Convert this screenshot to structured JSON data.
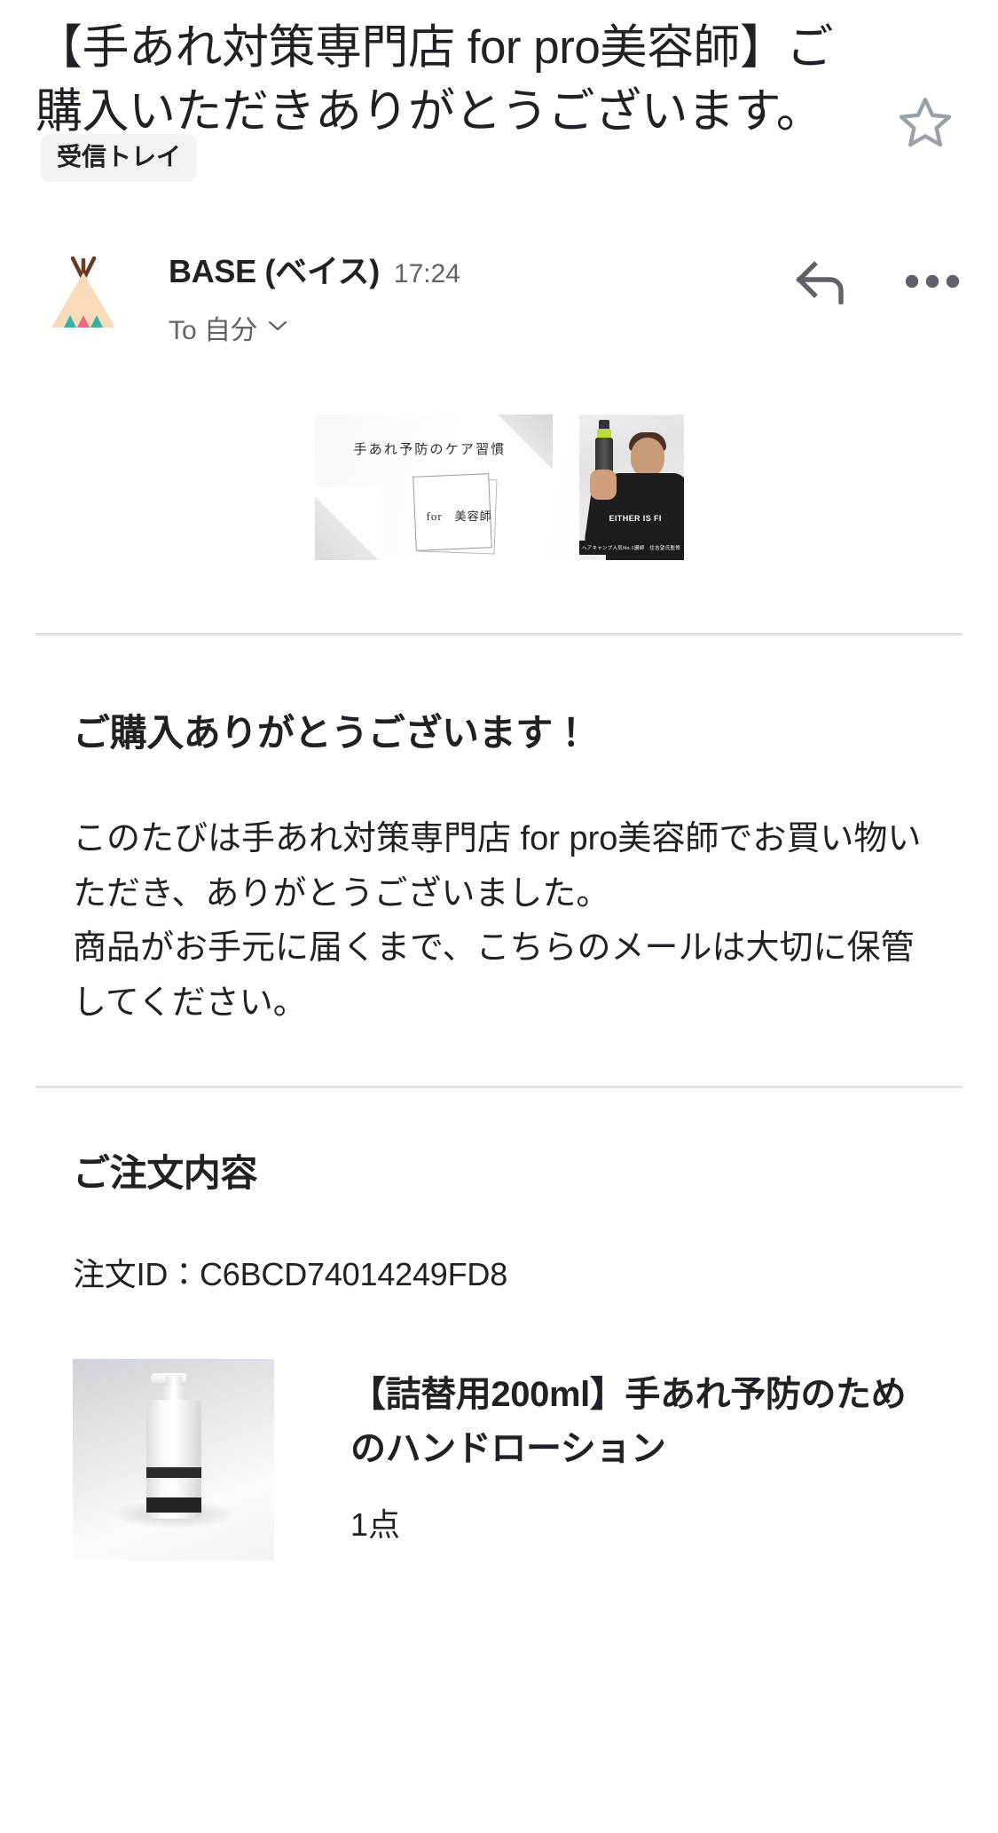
{
  "header": {
    "subject": "【手あれ対策専門店 for pro美容師】ご購入いただきありがとうございます。",
    "label_chip": "受信トレイ",
    "star_icon": "star-outline-icon"
  },
  "sender": {
    "avatar_icon": "teepee-avatar-icon",
    "name": "BASE (ベイス)",
    "time": "17:24",
    "recipient": "To 自分",
    "expand_icon": "chevron-down-icon",
    "reply_icon": "reply-arrow-icon",
    "more_icon": "more-options-icon"
  },
  "banner": {
    "headline": "手あれ予防のケア習慣",
    "card_text": "for　美容師",
    "shirt_text": "EITHER IS FI",
    "caption": "ヘアキャンプ人気No.1講師　住吉望氏監修"
  },
  "body": {
    "greeting": "ご購入ありがとうございます！",
    "paragraph": "このたびは手あれ対策専門店 for pro美容師でお買い物いただき、ありがとうございました。\n商品がお手元に届くまで、こちらのメールは大切に保管してください。"
  },
  "order": {
    "section_title": "ご注文内容",
    "order_id_line": "注文ID：C6BCD74014249FD8",
    "order_id": "C6BCD74014249FD8",
    "items": [
      {
        "name": "【詰替用200ml】手あれ予防のためのハンドローション",
        "quantity": "1点",
        "thumb_icon": "product-bottle-thumbnail"
      }
    ]
  },
  "colors": {
    "text_primary": "#202124",
    "text_secondary": "#5f6368",
    "chip_bg": "#f1f3f4",
    "divider": "#dde1e4",
    "star": "#9aa0a6",
    "avatar_body": "#f8dcb9",
    "avatar_pole": "#6b3a26",
    "avatar_teal": "#35b2a6",
    "avatar_pink": "#e8687f"
  }
}
